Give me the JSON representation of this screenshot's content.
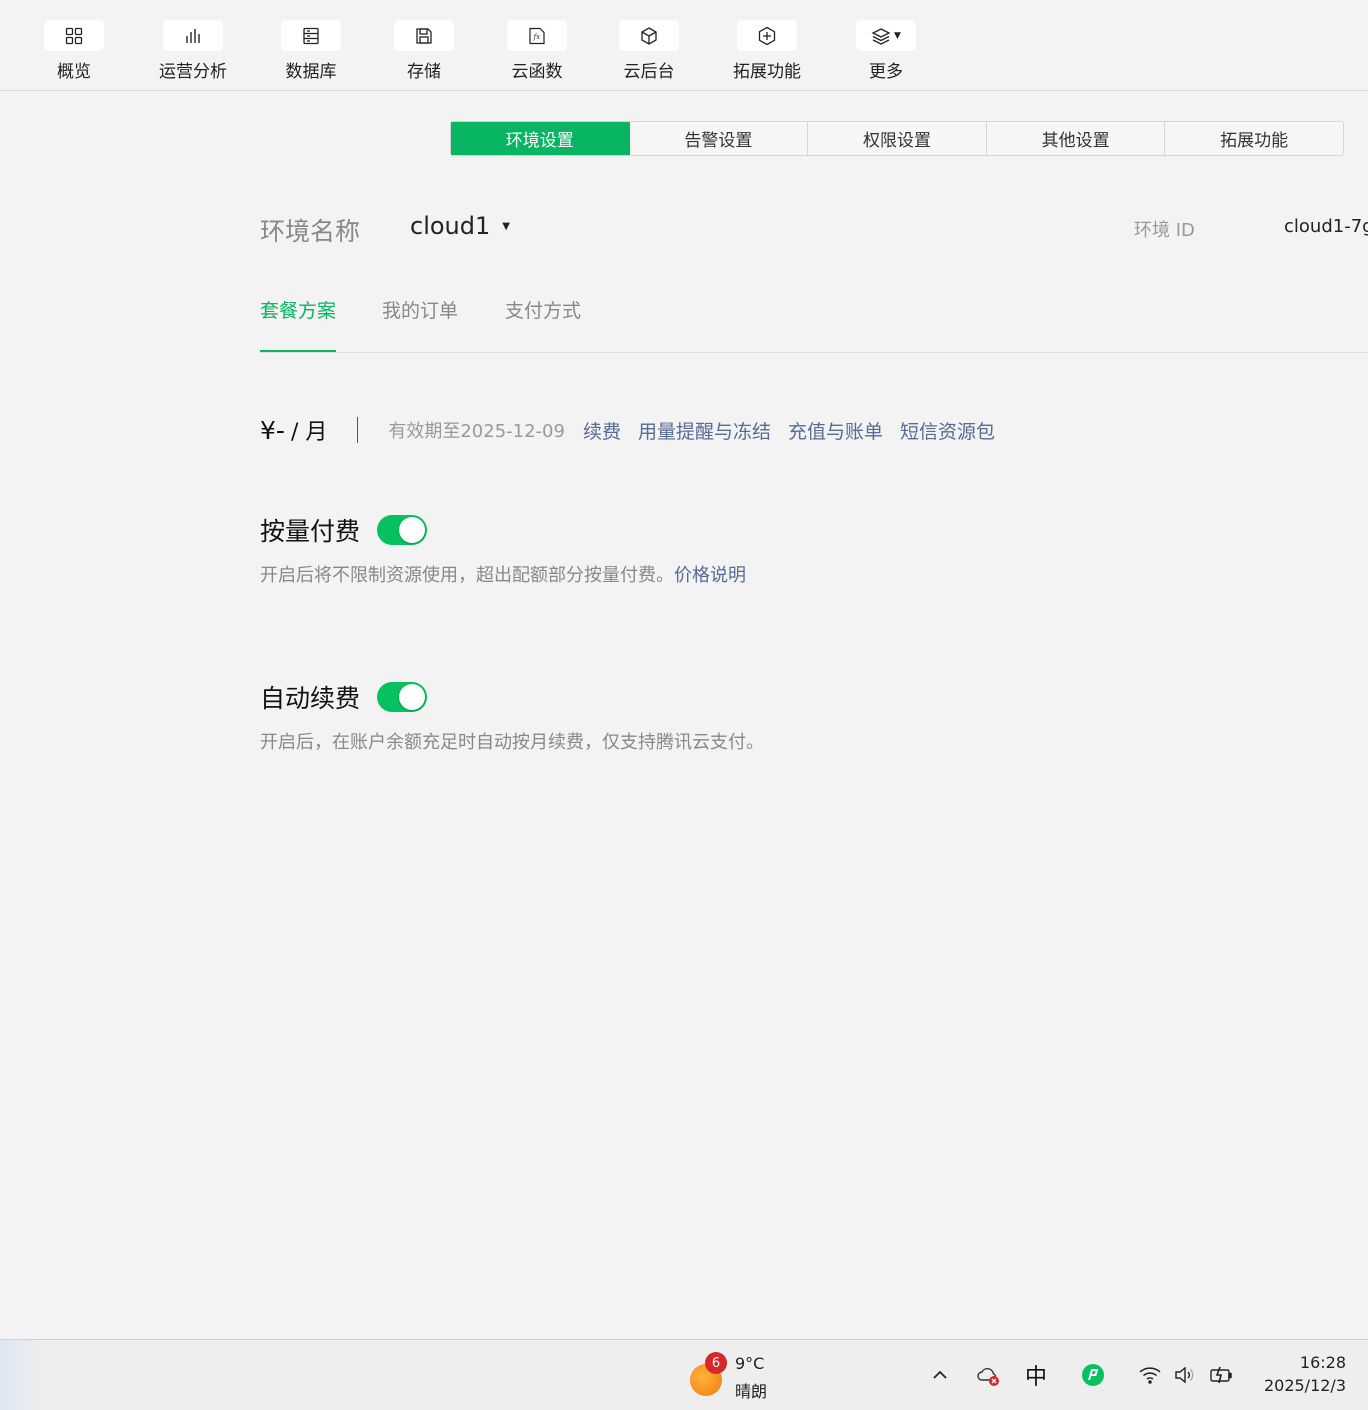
{
  "toolbar": {
    "items": [
      {
        "label": "概览",
        "icon": "grid-icon"
      },
      {
        "label": "运营分析",
        "icon": "bar-chart-icon"
      },
      {
        "label": "数据库",
        "icon": "database-icon"
      },
      {
        "label": "存储",
        "icon": "save-icon"
      },
      {
        "label": "云函数",
        "icon": "function-icon"
      },
      {
        "label": "云后台",
        "icon": "cube-icon"
      },
      {
        "label": "拓展功能",
        "icon": "plus-hexagon-icon"
      },
      {
        "label": "更多",
        "icon": "layers-icon"
      }
    ]
  },
  "settings_tabs": [
    "环境设置",
    "告警设置",
    "权限设置",
    "其他设置",
    "拓展功能"
  ],
  "settings_tabs_active": 0,
  "env": {
    "name_label": "环境名称",
    "name_value": "cloud1",
    "id_label": "环境 ID",
    "id_value": "cloud1-7g"
  },
  "subtabs": [
    "套餐方案",
    "我的订单",
    "支付方式"
  ],
  "subtabs_active": 0,
  "plan": {
    "price": "¥-",
    "unit": "/ 月",
    "validity": "有效期至2025-12-09",
    "links": [
      "续费",
      "用量提醒与冻结",
      "充值与账单",
      "短信资源包"
    ]
  },
  "options": [
    {
      "title": "按量付费",
      "enabled": true,
      "desc": "开启后将不限制资源使用，超出配额部分按量付费。",
      "link": "价格说明"
    },
    {
      "title": "自动续费",
      "enabled": true,
      "desc": "开启后，在账户余额充足时自动按月续费，仅支持腾讯云支付。",
      "link": ""
    }
  ],
  "colors": {
    "accent": "#07b563",
    "toggle_on": "#07c160",
    "link": "#576b95",
    "muted_text": "#888888",
    "background": "#f3f3f3"
  },
  "taskbar": {
    "weather_badge": "6",
    "weather_temp": "9°C",
    "weather_desc": "晴朗",
    "ime": "中",
    "time": "16:28",
    "date": "2025/12/3"
  }
}
